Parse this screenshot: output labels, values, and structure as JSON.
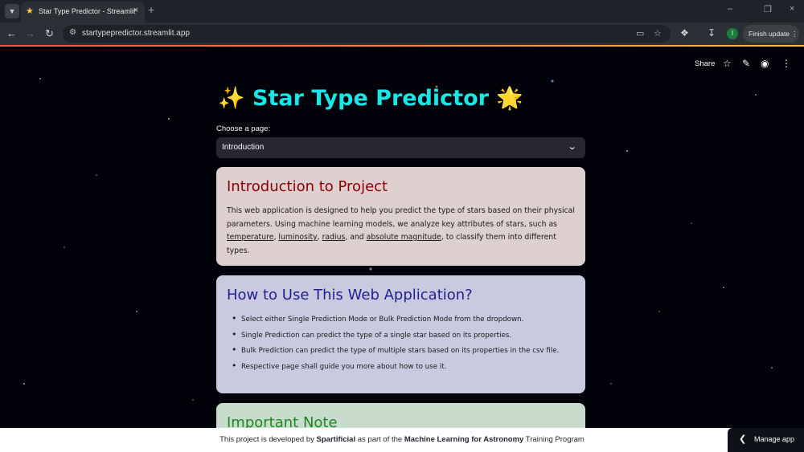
{
  "browser": {
    "tab_title": "Star Type Predictor - Streamlit",
    "url": "startypepredictor.streamlit.app",
    "finish_update": "Finish update",
    "profile_initial": "I",
    "icons": {
      "tab_favicon": "star-icon",
      "menu": "chevron-down-icon",
      "close_tab": "close-icon",
      "new_tab": "plus-icon",
      "back": "back-icon",
      "forward": "forward-icon",
      "reload": "reload-icon",
      "site_info": "site-info-icon",
      "cast": "cast-icon",
      "bookmark": "star-outline-icon",
      "extensions": "puzzle-icon",
      "download": "download-icon",
      "more": "more-vertical-icon"
    }
  },
  "app_header": {
    "share": "Share",
    "icons": [
      "star-outline-icon",
      "pencil-icon",
      "github-icon",
      "more-vertical-icon"
    ]
  },
  "page": {
    "title": "Star Type Predictor",
    "title_emoji_left": "✨",
    "title_emoji_right": "🌟",
    "select_label": "Choose a page:",
    "select_value": "Introduction"
  },
  "intro": {
    "heading": "Introduction to Project",
    "text_1": "This web application is designed to help you predict the type of stars based on their physical parameters. Using machine learning models, we analyze key attributes of stars, such as ",
    "attributes": [
      "temperature",
      "luminosity",
      "radius",
      "absolute magnitude"
    ],
    "sep_1": ", ",
    "sep_2": ", ",
    "sep_3": ", and ",
    "text_2": ", to classify them into different types."
  },
  "howto": {
    "heading": "How to Use This Web Application?",
    "items": [
      "Select either Single Prediction Mode or Bulk Prediction Mode from the dropdown.",
      "Single Prediction can predict the type of a single star based on its properties.",
      "Bulk Prediction can predict the type of multiple stars based on its properties in the csv file.",
      "Respective page shall guide you more about how to use it."
    ]
  },
  "note": {
    "heading": "Important Note"
  },
  "footer": {
    "pre": "This project is developed by ",
    "org": "Spartificial",
    "mid": " as part of the ",
    "program": "Machine Learning for Astronomy",
    "post": " Training Program"
  },
  "manage_app": "Manage app",
  "colors": {
    "title": "#19e6e6",
    "intro_heading": "#8b0000",
    "howto_heading": "#1f1f8f",
    "note_heading": "#1c8a1c",
    "accent": "#ff4b4b"
  }
}
